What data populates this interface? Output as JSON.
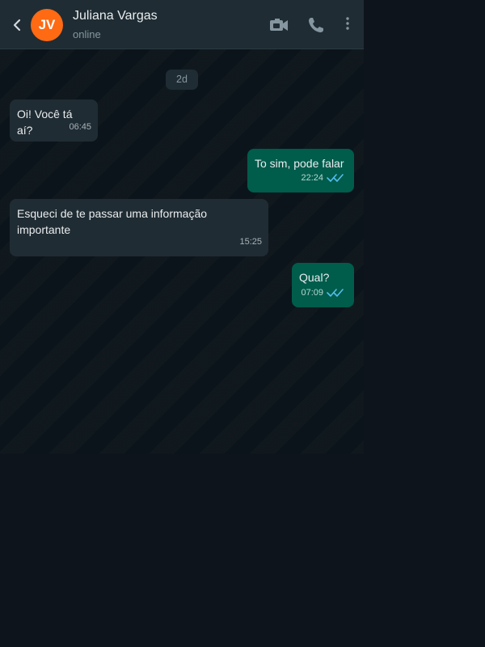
{
  "header": {
    "back_icon": "chevron-left-icon",
    "avatar_initials": "JV",
    "avatar_color": "#ff6a13",
    "contact_name": "Juliana Vargas",
    "status": "online",
    "icons": [
      "video-camera-icon",
      "phone-icon",
      "more-vertical-icon"
    ]
  },
  "chat": {
    "date_chip": "2d",
    "messages": [
      {
        "direction": "in",
        "text": "Oi! Você tá aí?",
        "time": "06:45"
      },
      {
        "direction": "out",
        "text": "To sim, pode falar",
        "time": "22:24",
        "status": "read"
      },
      {
        "direction": "in",
        "text": "Esqueci de te passar uma informação importante",
        "time": "15:25"
      },
      {
        "direction": "out",
        "text": "Qual?",
        "time": "07:09",
        "status": "read"
      }
    ]
  },
  "colors": {
    "header_bg": "#1f2c33",
    "chat_bg": "#0b141a",
    "incoming_bubble": "#202c33",
    "outgoing_bubble": "#005c4b",
    "read_ticks": "#53bdeb"
  }
}
